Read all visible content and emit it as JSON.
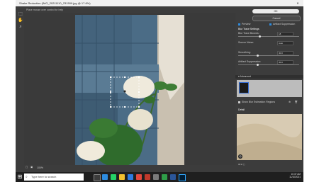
{
  "window": {
    "title": "Shake Reduction (IMG_20211110_231509.jpg @ 17.6%)",
    "close_glyph": "✕"
  },
  "canvas": {
    "hint": "Place mouse over control for help",
    "zoom_value": "100%"
  },
  "panel": {
    "ok_label": "OK",
    "cancel_label": "Cancel",
    "preview_label": "Preview",
    "artifact_suppression_label": "Artifact Suppression",
    "blur_trace_settings_label": "Blur Trace Settings",
    "blur_trace_bounds_label": "Blur Trace Bounds:",
    "blur_trace_bounds_value": "18",
    "source_noise_label": "Source Noise:",
    "source_noise_value": "Auto",
    "smoothing_label": "Smoothing:",
    "smoothing_value": "30.0",
    "artifact_suppression_value_label": "Artifact Suppression:",
    "artifact_suppression_value": "30.0",
    "advanced_label": "Advanced",
    "show_blur_regions_label": "Show Blur Estimation Regions",
    "detail_label": "Detail"
  },
  "taskbar": {
    "search_placeholder": "Type here to search",
    "time": "10:37 AM",
    "date": "11/10/2021"
  },
  "colors": {
    "accent": "#2d8ce0",
    "panel_bg": "#3c3c3c"
  }
}
